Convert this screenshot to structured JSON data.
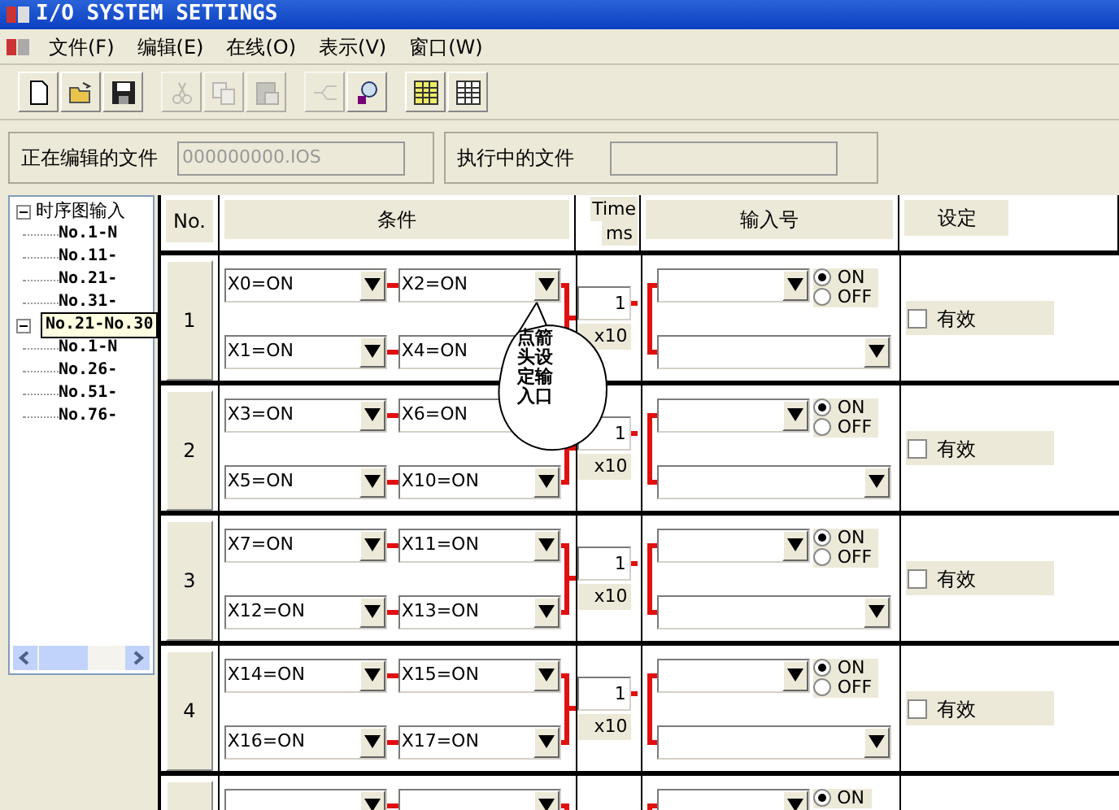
{
  "window": {
    "title": "I/O SYSTEM SETTINGS"
  },
  "menu": [
    "文件(F)",
    "编辑(E)",
    "在线(O)",
    "表示(V)",
    "窗口(W)"
  ],
  "toolbar": [
    {
      "kind": "new",
      "disabled": false
    },
    {
      "kind": "open",
      "disabled": false
    },
    {
      "kind": "save",
      "disabled": false
    },
    {
      "kind": "cut",
      "disabled": true
    },
    {
      "kind": "copy",
      "disabled": true
    },
    {
      "kind": "paste",
      "disabled": true
    },
    {
      "kind": "wizard",
      "disabled": true
    },
    {
      "kind": "find",
      "disabled": false
    },
    {
      "kind": "table",
      "disabled": false
    },
    {
      "kind": "grid",
      "disabled": false
    }
  ],
  "files": {
    "editing_label": "正在编辑的文件",
    "editing_value": "000000000.IOS",
    "running_label": "执行中的文件"
  },
  "tree": [
    {
      "label": "时序图输入",
      "expanded": true,
      "children": [
        "No.1-N",
        "No.11-",
        "No.21-",
        "No.31-"
      ]
    },
    {
      "expanded": true,
      "children": [
        "No.1-N",
        "No.26-",
        "No.51-",
        "No.76-"
      ]
    }
  ],
  "tooltip": "No.21-No.30",
  "table": {
    "columns": [
      "No.",
      "条件",
      "Time",
      "ms",
      "输入号",
      "设定"
    ],
    "rows": [
      {
        "no": "1",
        "conditions": [
          "X0=ON",
          "X2=ON",
          "X1=ON",
          "X4=ON"
        ],
        "time": "1",
        "unit": "x10",
        "on": true,
        "off": false,
        "on_label": "ON",
        "off_label": "OFF",
        "valid": "有效",
        "checked": false
      },
      {
        "no": "2",
        "conditions": [
          "X3=ON",
          "X6=ON",
          "X5=ON",
          "X10=ON"
        ],
        "time": "1",
        "unit": "x10",
        "on": true,
        "off": false,
        "on_label": "ON",
        "off_label": "OFF",
        "valid": "有效",
        "checked": false
      },
      {
        "no": "3",
        "conditions": [
          "X7=ON",
          "X11=ON",
          "X12=ON",
          "X13=ON"
        ],
        "time": "1",
        "unit": "x10",
        "on": true,
        "off": false,
        "on_label": "ON",
        "off_label": "OFF",
        "valid": "有效",
        "checked": false
      },
      {
        "no": "4",
        "conditions": [
          "X14=ON",
          "X15=ON",
          "X16=ON",
          "X17=ON"
        ],
        "time": "1",
        "unit": "x10",
        "on": true,
        "off": false,
        "on_label": "ON",
        "off_label": "OFF",
        "valid": "有效",
        "checked": false
      },
      {
        "on": true,
        "on_label": "ON"
      }
    ]
  },
  "callout": "点箭头设定输入口"
}
